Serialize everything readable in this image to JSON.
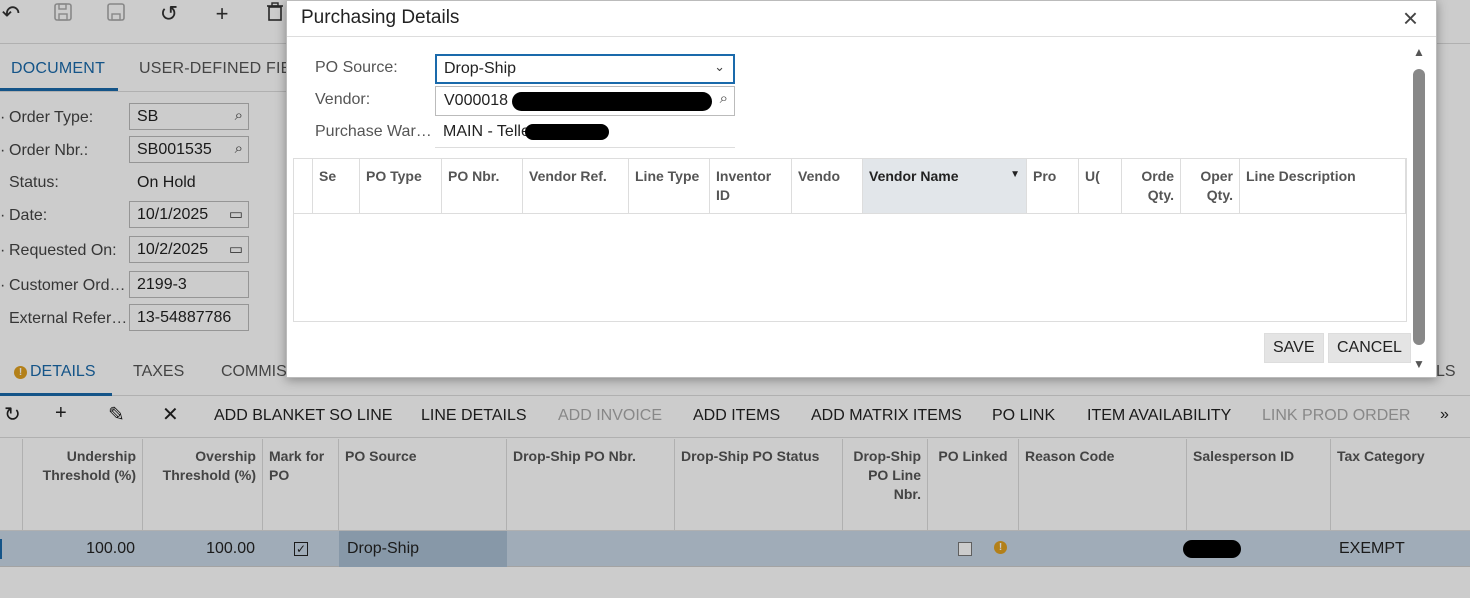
{
  "toolbar_top": {
    "icons": [
      "back-icon",
      "save-close-icon",
      "save-icon",
      "undo-icon",
      "add-icon",
      "delete-icon"
    ]
  },
  "doc_tabs": [
    "DOCUMENT",
    "USER-DEFINED FIE"
  ],
  "form": {
    "order_type": {
      "label": "Order Type:",
      "value": "SB"
    },
    "order_nbr": {
      "label": "Order Nbr.:",
      "value": "SB001535"
    },
    "status": {
      "label": "Status:",
      "value": "On Hold"
    },
    "date": {
      "label": "Date:",
      "value": "10/1/2025"
    },
    "requested_on": {
      "label": "Requested On:",
      "value": "10/2/2025"
    },
    "customer_ord": {
      "label": "Customer Ord…",
      "value": "2199-3"
    },
    "external_ref": {
      "label": "External Refer…",
      "value": "13-54887786"
    }
  },
  "details_tabs": [
    "DETAILS",
    "TAXES",
    "COMMIS",
    "LS"
  ],
  "details_toolbar": [
    {
      "label": "ADD BLANKET SO LINE",
      "enabled": true
    },
    {
      "label": "LINE DETAILS",
      "enabled": true
    },
    {
      "label": "ADD INVOICE",
      "enabled": false
    },
    {
      "label": "ADD ITEMS",
      "enabled": true
    },
    {
      "label": "ADD MATRIX ITEMS",
      "enabled": true
    },
    {
      "label": "PO LINK",
      "enabled": true
    },
    {
      "label": "ITEM AVAILABILITY",
      "enabled": true
    },
    {
      "label": "LINK PROD ORDER",
      "enabled": false
    }
  ],
  "lines_grid": {
    "columns": [
      "Undership Threshold (%)",
      "Overship Threshold (%)",
      "Mark for PO",
      "PO Source",
      "Drop-Ship PO Nbr.",
      "Drop-Ship PO Status",
      "Drop-Ship PO Line Nbr.",
      "PO Linked",
      "Reason Code",
      "Salesperson ID",
      "Tax Category"
    ],
    "row": {
      "undership": "100.00",
      "overship": "100.00",
      "mark_for_po": true,
      "po_source": "Drop-Ship",
      "po_linked": false,
      "tax_category": "EXEMPT"
    }
  },
  "modal": {
    "title": "Purchasing Details",
    "po_source": {
      "label": "PO Source:",
      "value": "Drop-Ship"
    },
    "vendor": {
      "label": "Vendor:",
      "value": "V000018 -"
    },
    "purchase_warehouse": {
      "label": "Purchase War…",
      "value": "MAIN - Tellerex"
    },
    "grid_columns": [
      "Se",
      "PO Type",
      "PO Nbr.",
      "Vendor Ref.",
      "Line Type",
      "Inventor ID",
      "Vendo",
      "Vendor Name",
      "Pro",
      "U(",
      "Orde Qty.",
      "Oper Qty.",
      "Line Description"
    ],
    "save_label": "SAVE",
    "cancel_label": "CANCEL"
  },
  "colors": {
    "accent": "#1a6aab",
    "warning": "#e0a020",
    "selected_row": "#c8d7e6"
  }
}
